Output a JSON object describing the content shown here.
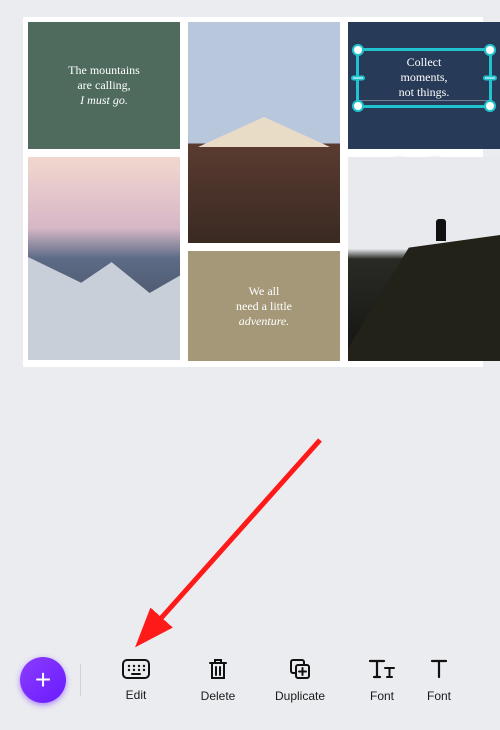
{
  "canvas": {
    "tiles": {
      "green": {
        "line1": "The mountains",
        "line2": "are calling,",
        "line3": "I must go."
      },
      "navy_selected": {
        "line1": "Collect",
        "line2": "moments,",
        "line3": "not things."
      },
      "khaki": {
        "line1": "We all",
        "line2": "need a little",
        "line3": "adventure."
      }
    },
    "rotate_label": "↻",
    "move_label": "✥"
  },
  "toolbar": {
    "add_label": "+",
    "edit": "Edit",
    "delete": "Delete",
    "duplicate": "Duplicate",
    "font": "Font",
    "font2": "Font"
  }
}
